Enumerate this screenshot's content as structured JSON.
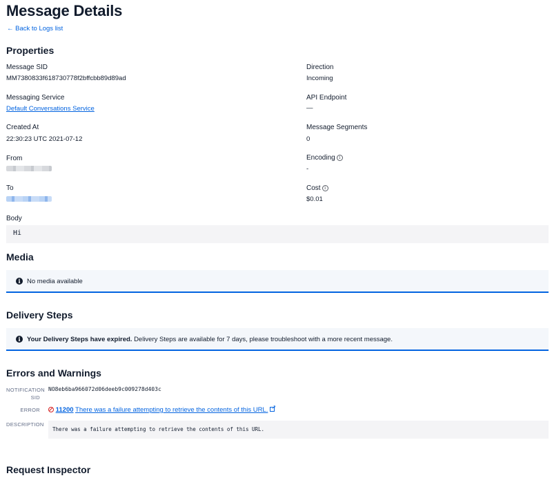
{
  "page": {
    "title": "Message Details",
    "back_link": "← Back to Logs list"
  },
  "properties": {
    "heading": "Properties",
    "message_sid": {
      "label": "Message SID",
      "value": "MM7380833f618730778f2bffcbb89d89ad"
    },
    "direction": {
      "label": "Direction",
      "value": "Incoming"
    },
    "messaging_service": {
      "label": "Messaging Service",
      "value": "Default Conversations Service"
    },
    "api_endpoint": {
      "label": "API Endpoint",
      "value": "—"
    },
    "created_at": {
      "label": "Created At",
      "value": "22:30:23 UTC 2021-07-12"
    },
    "message_segments": {
      "label": "Message Segments",
      "value": "0"
    },
    "from": {
      "label": "From"
    },
    "encoding": {
      "label": "Encoding",
      "value": "-"
    },
    "to": {
      "label": "To"
    },
    "cost": {
      "label": "Cost",
      "value": "$0.01"
    },
    "body": {
      "label": "Body",
      "value": "Hi"
    }
  },
  "media": {
    "heading": "Media",
    "notice": "No media available"
  },
  "delivery_steps": {
    "heading": "Delivery Steps",
    "notice_bold": "Your Delivery Steps have expired.",
    "notice_text": "Delivery Steps are available for 7 days, please troubleshoot with a more recent message."
  },
  "errors": {
    "heading": "Errors and Warnings",
    "notification_sid_label_1": "NOTIFICATION",
    "notification_sid_label_2": "SID",
    "notification_sid": "NO8eb6ba966072d06deeb9c009278d403c",
    "error_label": "ERROR",
    "error_code": "11200",
    "error_text": "There was a failure attempting to retrieve the contents of this URL.",
    "description_label": "DESCRIPTION",
    "description": "There was a failure attempting to retrieve the contents of this URL."
  },
  "request_inspector": {
    "heading": "Request Inspector"
  },
  "icons": {
    "back": "arrow-left-icon",
    "info": "info-icon",
    "tooltip": "tooltip-info-icon",
    "error": "ban-icon",
    "external": "external-link-icon"
  }
}
